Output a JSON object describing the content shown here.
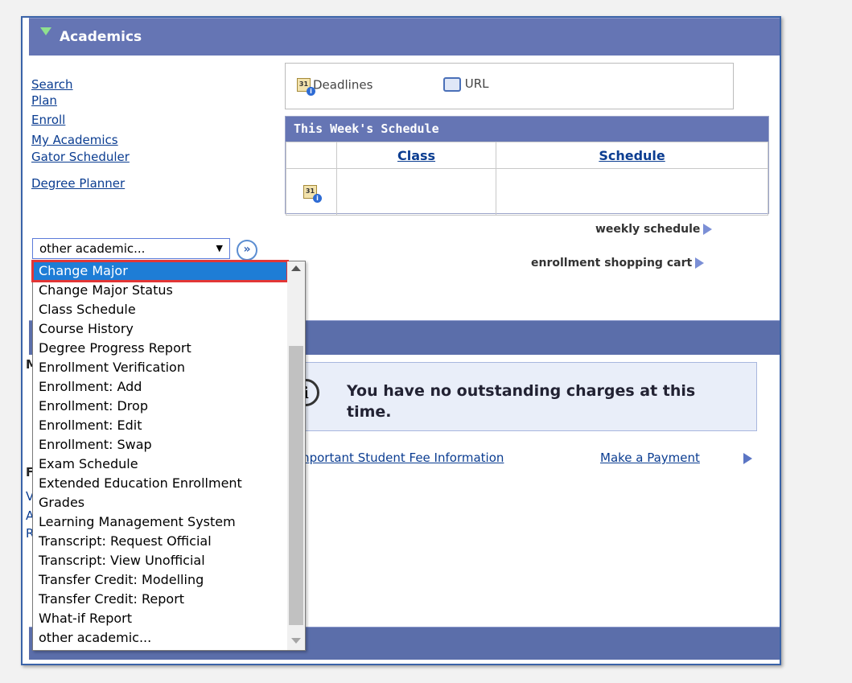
{
  "academics": {
    "title": "Academics",
    "links": [
      "Search",
      "Plan",
      "Enroll",
      "My Academics",
      "Gator Scheduler",
      "Degree Planner"
    ],
    "select_value": "other academic...",
    "go_label": "»",
    "options": [
      "Change Major",
      "Change Major Status",
      "Class Schedule",
      "Course History",
      "Degree Progress Report",
      "Enrollment Verification",
      "Enrollment: Add",
      "Enrollment: Drop",
      "Enrollment: Edit",
      "Enrollment: Swap",
      "Exam Schedule",
      "Extended Education Enrollment",
      "Grades",
      "Learning Management System",
      "Transcript: Request Official",
      "Transcript: View Unofficial",
      "Transfer Credit: Modelling",
      "Transfer Credit: Report",
      "What-if Report",
      "other academic..."
    ]
  },
  "toolbar": {
    "deadlines": "Deadlines",
    "url": "URL"
  },
  "schedule": {
    "title": "This Week's Schedule",
    "columns": [
      "Class",
      "Schedule"
    ],
    "weekly_link": "weekly schedule",
    "cart_link": "enrollment shopping cart"
  },
  "finances": {
    "notice": "You have no outstanding charges at this time.",
    "fee_link": "mportant Student Fee Information",
    "pay_link": "Make a Payment",
    "fragments": [
      "M",
      "F",
      "V",
      "A",
      "R"
    ]
  },
  "colors": {
    "header": "#6575b4",
    "selected": "#1e7dd6",
    "highlight": "#e23636",
    "link": "#0b3d91"
  }
}
